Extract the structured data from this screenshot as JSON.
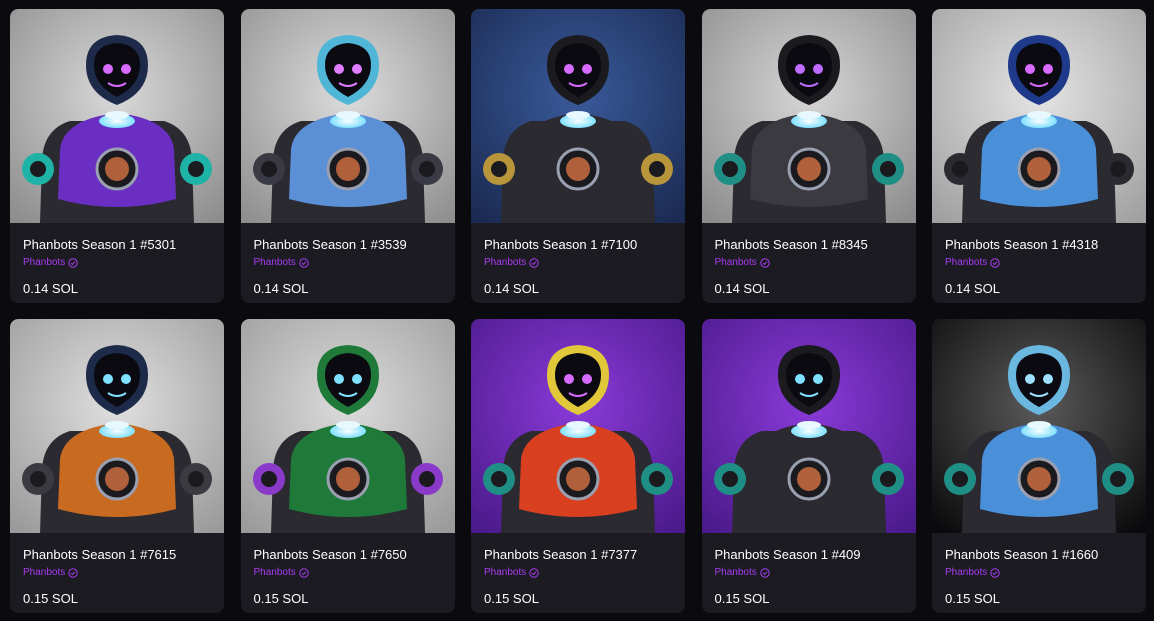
{
  "listings": [
    {
      "name": "Phanbots Season 1 #5301",
      "collection": "Phanbots",
      "price": "0.14 SOL",
      "bg": [
        "#8d8d8d",
        "#d9d9d9"
      ],
      "body": "#6a2fc2",
      "accent": "#1fb3a8",
      "head": "#1e2a4a",
      "eyes": "#d86bff"
    },
    {
      "name": "Phanbots Season 1 #3539",
      "collection": "Phanbots",
      "price": "0.14 SOL",
      "bg": [
        "#8f8f8f",
        "#dcdcdc"
      ],
      "body": "#5b8fd6",
      "accent": "#3a3a44",
      "head": "#4fb6d8",
      "eyes": "#e07dff"
    },
    {
      "name": "Phanbots Season 1 #7100",
      "collection": "Phanbots",
      "price": "0.14 SOL",
      "bg": [
        "#1a2a52",
        "#3a5a9a"
      ],
      "body": "#2a2a30",
      "accent": "#b8943a",
      "head": "#1a1a1f",
      "eyes": "#d86bff"
    },
    {
      "name": "Phanbots Season 1 #8345",
      "collection": "Phanbots",
      "price": "0.14 SOL",
      "bg": [
        "#8c8c8c",
        "#d6d6d6"
      ],
      "body": "#3a3a40",
      "accent": "#1f8f86",
      "head": "#1a1a1f",
      "eyes": "#c06bff"
    },
    {
      "name": "Phanbots Season 1 #4318",
      "collection": "Phanbots",
      "price": "0.14 SOL",
      "bg": [
        "#a0a0a0",
        "#e4e4e4"
      ],
      "body": "#4a90d9",
      "accent": "#2a2a30",
      "head": "#1f3a8a",
      "eyes": "#d86bff"
    },
    {
      "name": "Phanbots Season 1 #7615",
      "collection": "Phanbots",
      "price": "0.15 SOL",
      "bg": [
        "#9a9a9a",
        "#e0e0e0"
      ],
      "body": "#c86a1f",
      "accent": "#3a3a40",
      "head": "#1e2a4a",
      "eyes": "#7fe0ff"
    },
    {
      "name": "Phanbots Season 1 #7650",
      "collection": "Phanbots",
      "price": "0.15 SOL",
      "bg": [
        "#9a9a9a",
        "#dcdcdc"
      ],
      "body": "#1f7a3a",
      "accent": "#8a3ac8",
      "head": "#1f7a3a",
      "eyes": "#7fe0ff"
    },
    {
      "name": "Phanbots Season 1 #7377",
      "collection": "Phanbots",
      "price": "0.15 SOL",
      "bg": [
        "#4a1a8a",
        "#8a3ad8"
      ],
      "body": "#d8401f",
      "accent": "#1f8f86",
      "head": "#e0c83a",
      "eyes": "#d86bff"
    },
    {
      "name": "Phanbots Season 1 #409",
      "collection": "Phanbots",
      "price": "0.15 SOL",
      "bg": [
        "#4a1a8a",
        "#8a3ad8"
      ],
      "body": "#2a2a30",
      "accent": "#1f8f86",
      "head": "#1a1a1f",
      "eyes": "#7fe0ff"
    },
    {
      "name": "Phanbots Season 1 #1660",
      "collection": "Phanbots",
      "price": "0.15 SOL",
      "bg": [
        "#0a0a0c",
        "#5a5a5a"
      ],
      "body": "#4a90d9",
      "accent": "#1f8f86",
      "head": "#6ab8e0",
      "eyes": "#a0e0ff"
    }
  ]
}
